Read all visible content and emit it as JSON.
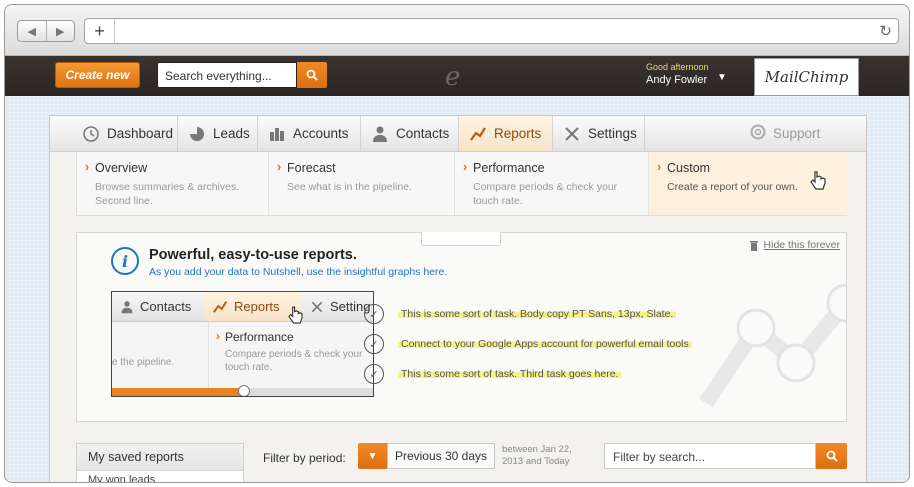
{
  "header": {
    "create_label": "Create new",
    "search_value": "Search everything...",
    "greeting": "Good afternoon",
    "user_name": "Andy Fowler",
    "partner_logo": "MailChimp"
  },
  "nav": {
    "tabs": [
      {
        "label": "Dashboard",
        "icon": "clock-icon"
      },
      {
        "label": "Leads",
        "icon": "pie-icon"
      },
      {
        "label": "Accounts",
        "icon": "buildings-icon"
      },
      {
        "label": "Contacts",
        "icon": "person-icon"
      },
      {
        "label": "Reports",
        "icon": "chart-line-icon"
      },
      {
        "label": "Settings",
        "icon": "tools-icon"
      }
    ],
    "support_label": "Support",
    "active_tab": "Reports"
  },
  "submenu": [
    {
      "title": "Overview",
      "desc1": "Browse summaries & archives.",
      "desc2": "Second line."
    },
    {
      "title": "Forecast",
      "desc1": "See what is in the pipeline.",
      "desc2": ""
    },
    {
      "title": "Performance",
      "desc1": "Compare periods & check your",
      "desc2": "touch rate."
    },
    {
      "title": "Custom",
      "desc1": "Create a report of your own.",
      "desc2": ""
    }
  ],
  "onboarding": {
    "title": "Powerful, easy-to-use reports.",
    "subtitle": "As you add your data to Nutshell, use the insightful graphs here.",
    "hide_label": "Hide this forever",
    "mini": {
      "tabs": [
        "Contacts",
        "Reports",
        "Setting"
      ],
      "fragment": "e the pipeline.",
      "perf_title": "Performance",
      "perf_desc1": "Compare periods & check your",
      "perf_desc2": "touch rate.",
      "progress": 0.5
    },
    "tasks": [
      "This is some sort of task. Body copy PT Sans, 13px, Slate.",
      "Connect to your Google Apps account for powerful email tools",
      "This is some sort of task. Third task goes here."
    ]
  },
  "bottom": {
    "saved_title": "My saved reports",
    "saved_item": "My won leads",
    "filter_label": "Filter by period:",
    "period_value": "Previous 30 days",
    "period_range_1": "between Jan 22,",
    "period_range_2": "2013 and Today",
    "filter_search": "Filter by search..."
  },
  "colors": {
    "accent": "#e8841f",
    "header": "#2f2a26",
    "link": "#1f76c0"
  }
}
